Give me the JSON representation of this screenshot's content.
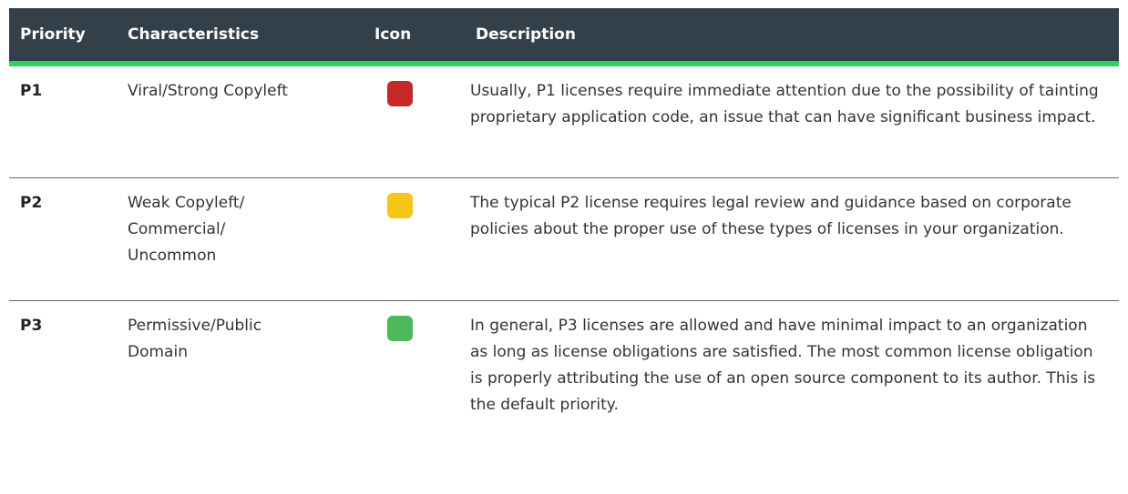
{
  "table": {
    "headers": {
      "priority": "Priority",
      "characteristics": "Characteristics",
      "icon": "Icon",
      "description": "Description"
    },
    "rows": [
      {
        "priority": "P1",
        "characteristics": "Viral/Strong Copyleft",
        "icon_name": "red-square-icon",
        "icon_color": "#c62828",
        "description": "Usually, P1 licenses require immediate attention due to the possibility of tainting proprietary application code, an issue that can have significant business impact."
      },
      {
        "priority": "P2",
        "characteristics": "Weak Copyleft/ Commercial/ Uncommon",
        "icon_name": "yellow-square-icon",
        "icon_color": "#f5c518",
        "description": "The typical P2 license requires legal review and guidance based on corporate policies about the proper use of these types of licenses in your organization."
      },
      {
        "priority": "P3",
        "characteristics": "Permissive/Public Domain",
        "icon_name": "green-square-icon",
        "icon_color": "#4cba5a",
        "description": "In general, P3 licenses are allowed and have minimal impact to an organization as long as license obligations are satisfied. The most common license obligation is properly attributing the use of an open source component to its author. This is the default priority."
      }
    ],
    "colors": {
      "header_bg": "#333f49",
      "header_accent": "#2bd361"
    }
  }
}
